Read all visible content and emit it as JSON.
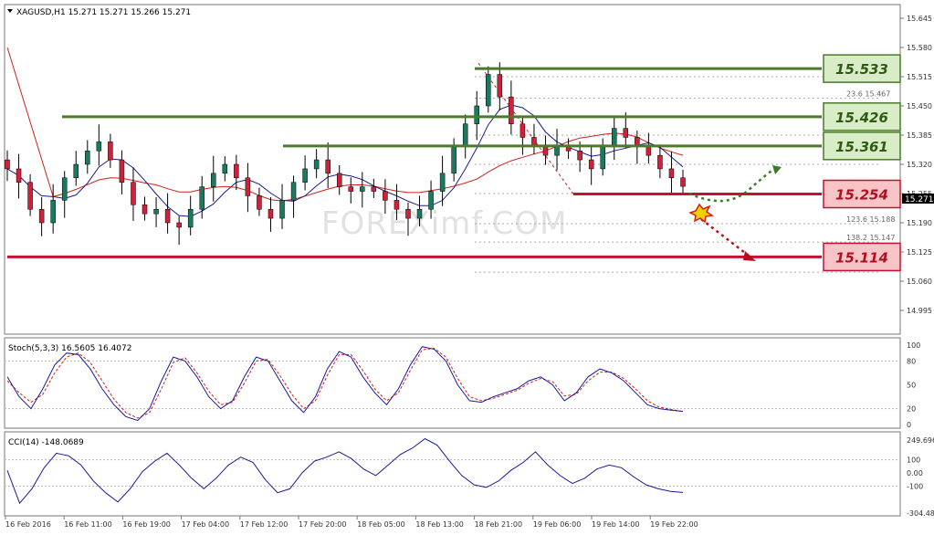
{
  "header": {
    "symbol_line": "XAGUSD,H1  15.271 15.271 15.266 15.271"
  },
  "watermark": "FOREXimf.COM",
  "price_axis": {
    "ticks": [
      "15.645",
      "15.580",
      "15.515",
      "15.450",
      "15.385",
      "15.320",
      "15.255",
      "15.190",
      "15.125",
      "15.060",
      "14.995"
    ],
    "current_price": "15.271"
  },
  "time_axis": {
    "labels": [
      "16 Feb 2016",
      "16 Feb 11:00",
      "16 Feb 19:00",
      "17 Feb 04:00",
      "17 Feb 12:00",
      "17 Feb 20:00",
      "18 Feb 05:00",
      "18 Feb 13:00",
      "18 Feb 21:00",
      "19 Feb 06:00",
      "19 Feb 14:00",
      "19 Feb 22:00"
    ]
  },
  "levels": [
    {
      "name": "resistance-1",
      "label": "15.533",
      "value": 15.533,
      "kind": "resistance"
    },
    {
      "name": "resistance-2",
      "label": "15.426",
      "value": 15.426,
      "kind": "resistance"
    },
    {
      "name": "resistance-3",
      "label": "15.361",
      "value": 15.361,
      "kind": "resistance"
    },
    {
      "name": "support-1",
      "label": "15.254",
      "value": 15.254,
      "kind": "support"
    },
    {
      "name": "support-2",
      "label": "15.114",
      "value": 15.114,
      "kind": "support"
    }
  ],
  "fibonacci": [
    {
      "label": "23.6  15.467",
      "value": 15.467
    },
    {
      "label": "123.6  15.188",
      "value": 15.188
    },
    {
      "label": "138.2  15.147",
      "value": 15.147
    }
  ],
  "stochastic": {
    "title": "Stoch(5,3,3) 16.5605 16.4072",
    "ticks": [
      "100",
      "80",
      "50",
      "20",
      "0"
    ]
  },
  "cci": {
    "title": "CCI(14) -148.0689",
    "ticks": [
      "249.696",
      "100",
      "0.00",
      "-100",
      "-304.489"
    ]
  },
  "colors": {
    "bull": "#1a7a5e",
    "bear": "#d0203a",
    "resistance_line": "#4a7a2a",
    "resistance_box": "#d8ecc8",
    "support_line": "#c8102e",
    "support_box": "#f7c4c8",
    "ma_fast": "#1a1a8a",
    "ma_slow": "#d0201a",
    "stoch_main": "#1a1a9a",
    "stoch_signal": "#d0201a",
    "cci": "#1a1a9a"
  },
  "chart_data": {
    "type": "candlestick",
    "symbol": "XAGUSD",
    "timeframe": "H1",
    "x": [
      "16 Feb 2016",
      "16 Feb 11:00",
      "16 Feb 19:00",
      "17 Feb 04:00",
      "17 Feb 12:00",
      "17 Feb 20:00",
      "18 Feb 05:00",
      "18 Feb 13:00",
      "18 Feb 21:00",
      "19 Feb 06:00",
      "19 Feb 14:00",
      "19 Feb 22:00"
    ],
    "close_path": [
      15.31,
      15.28,
      15.22,
      15.19,
      15.24,
      15.29,
      15.32,
      15.35,
      15.37,
      15.33,
      15.28,
      15.23,
      15.21,
      15.22,
      15.19,
      15.18,
      15.22,
      15.27,
      15.3,
      15.32,
      15.29,
      15.25,
      15.22,
      15.2,
      15.24,
      15.28,
      15.31,
      15.33,
      15.3,
      15.27,
      15.26,
      15.27,
      15.26,
      15.24,
      15.22,
      15.2,
      15.22,
      15.26,
      15.3,
      15.36,
      15.41,
      15.45,
      15.52,
      15.47,
      15.41,
      15.38,
      15.36,
      15.34,
      15.36,
      15.35,
      15.33,
      15.31,
      15.36,
      15.4,
      15.38,
      15.36,
      15.34,
      15.31,
      15.29,
      15.271
    ],
    "ylim": [
      14.995,
      15.68
    ],
    "stoch_path": [
      60,
      35,
      20,
      45,
      75,
      90,
      88,
      70,
      45,
      25,
      10,
      5,
      20,
      55,
      85,
      80,
      60,
      35,
      20,
      30,
      60,
      85,
      80,
      55,
      30,
      15,
      35,
      70,
      92,
      85,
      60,
      40,
      25,
      45,
      75,
      98,
      95,
      80,
      50,
      30,
      28,
      35,
      40,
      45,
      55,
      60,
      50,
      30,
      40,
      60,
      70,
      65,
      55,
      40,
      25,
      20,
      18,
      16.56
    ],
    "stoch_signal_path": [
      55,
      40,
      28,
      38,
      65,
      85,
      90,
      78,
      55,
      32,
      15,
      8,
      15,
      45,
      78,
      84,
      65,
      42,
      25,
      28,
      52,
      80,
      82,
      62,
      38,
      20,
      30,
      62,
      88,
      88,
      68,
      45,
      30,
      40,
      68,
      94,
      96,
      85,
      58,
      35,
      30,
      33,
      38,
      43,
      52,
      58,
      54,
      36,
      38,
      55,
      66,
      66,
      58,
      45,
      30,
      22,
      19,
      16.41
    ],
    "stoch_ylim": [
      0,
      100
    ],
    "cci_path": [
      20,
      -230,
      -120,
      40,
      150,
      130,
      60,
      -60,
      -150,
      -220,
      -120,
      10,
      90,
      150,
      60,
      -40,
      -120,
      -40,
      60,
      120,
      80,
      -50,
      -150,
      -120,
      0,
      90,
      120,
      160,
      110,
      30,
      -20,
      60,
      140,
      190,
      260,
      210,
      90,
      -20,
      -90,
      -110,
      -60,
      20,
      80,
      160,
      60,
      -20,
      -80,
      -40,
      30,
      60,
      40,
      -30,
      -90,
      -120,
      -140,
      -148.07
    ],
    "cci_ylim": [
      -304.489,
      249.696
    ]
  }
}
